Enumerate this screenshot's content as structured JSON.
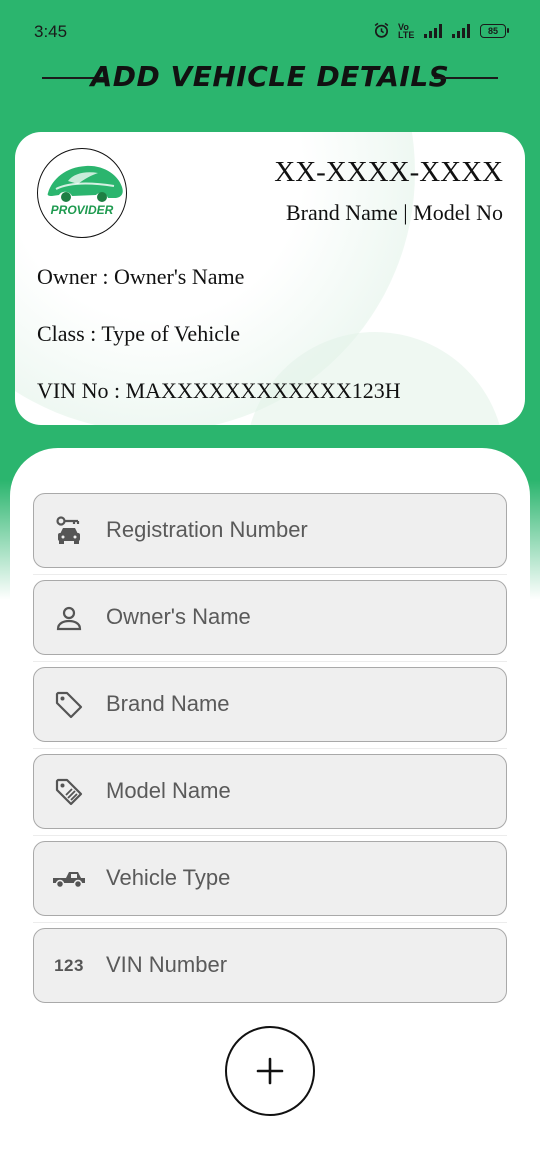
{
  "status_bar": {
    "time": "3:45",
    "volte": "Vo LTE",
    "battery": "85"
  },
  "header": {
    "title": "ADD VEHICLE DETAILS"
  },
  "card": {
    "logo_text": "PROVIDER",
    "registration_number": "XX-XXXX-XXXX",
    "brand_model": "Brand Name | Model No",
    "owner_line": "Owner : Owner's Name",
    "class_line": "Class : Type of Vehicle",
    "vin_line": "VIN No : MAXXXXXXXXXXXX123H"
  },
  "form": {
    "fields": [
      {
        "placeholder": "Registration Number",
        "icon": "car-key-icon"
      },
      {
        "placeholder": "Owner's Name",
        "icon": "person-icon"
      },
      {
        "placeholder": "Brand Name",
        "icon": "tag-icon"
      },
      {
        "placeholder": "Model Name",
        "icon": "discount-tag-icon"
      },
      {
        "placeholder": "Vehicle Type",
        "icon": "pickup-truck-icon"
      },
      {
        "placeholder": "VIN Number",
        "icon": "numbers-icon",
        "icon_text": "123"
      }
    ]
  },
  "colors": {
    "primary_green": "#2bb56e",
    "logo_green": "#1e9a4f",
    "field_bg": "#efefef"
  }
}
